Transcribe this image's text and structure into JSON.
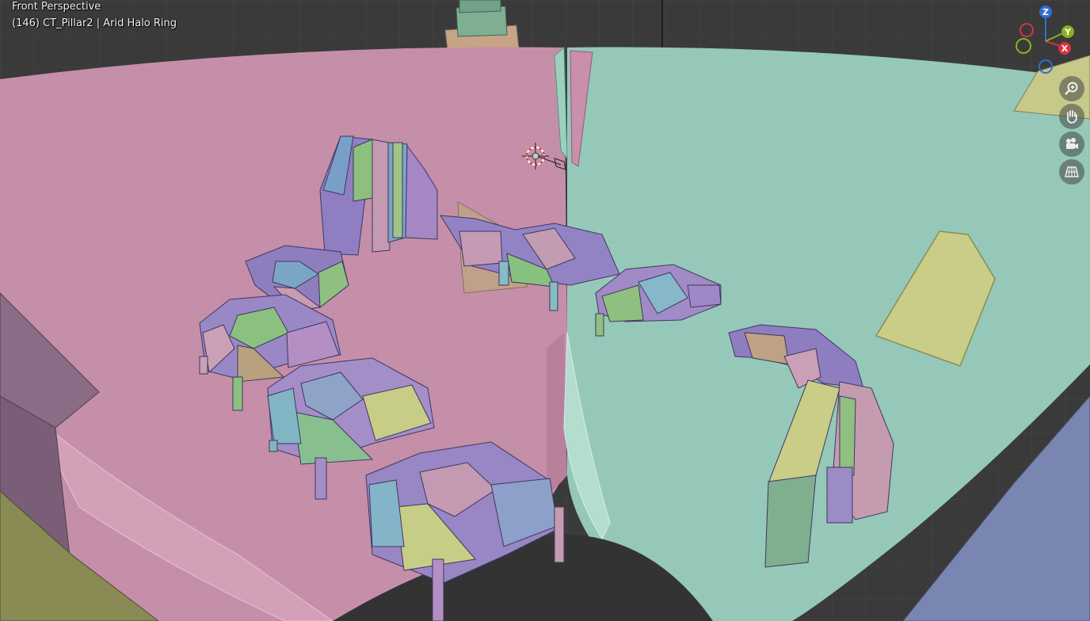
{
  "viewport": {
    "mode_label": "Front Perspective",
    "object_label": "(146) CT_Pillar2 | Arid Halo Ring"
  },
  "gizmo": {
    "z": "Z",
    "y": "Y",
    "x": "X",
    "colors": {
      "z": "#2f6fd4",
      "y": "#8bb01e",
      "x": "#d8323e"
    }
  },
  "nav_tools": [
    {
      "name": "zoom",
      "icon": "magnifier-plus-icon"
    },
    {
      "name": "pan",
      "icon": "hand-icon"
    },
    {
      "name": "camera",
      "icon": "camera-icon"
    },
    {
      "name": "orthographic",
      "icon": "grid-icon"
    }
  ],
  "scene_colors": {
    "background": "#3a3a3a",
    "pink_ring": "#c48ea8",
    "teal_ring": "#92c4b4",
    "yellow_prop": "#c7cc85",
    "block_blue": "#7aa0c0",
    "block_purple": "#9c8cc6",
    "block_green": "#8fbf7f",
    "block_pink": "#c59bb0",
    "block_tan": "#b9a17f"
  }
}
